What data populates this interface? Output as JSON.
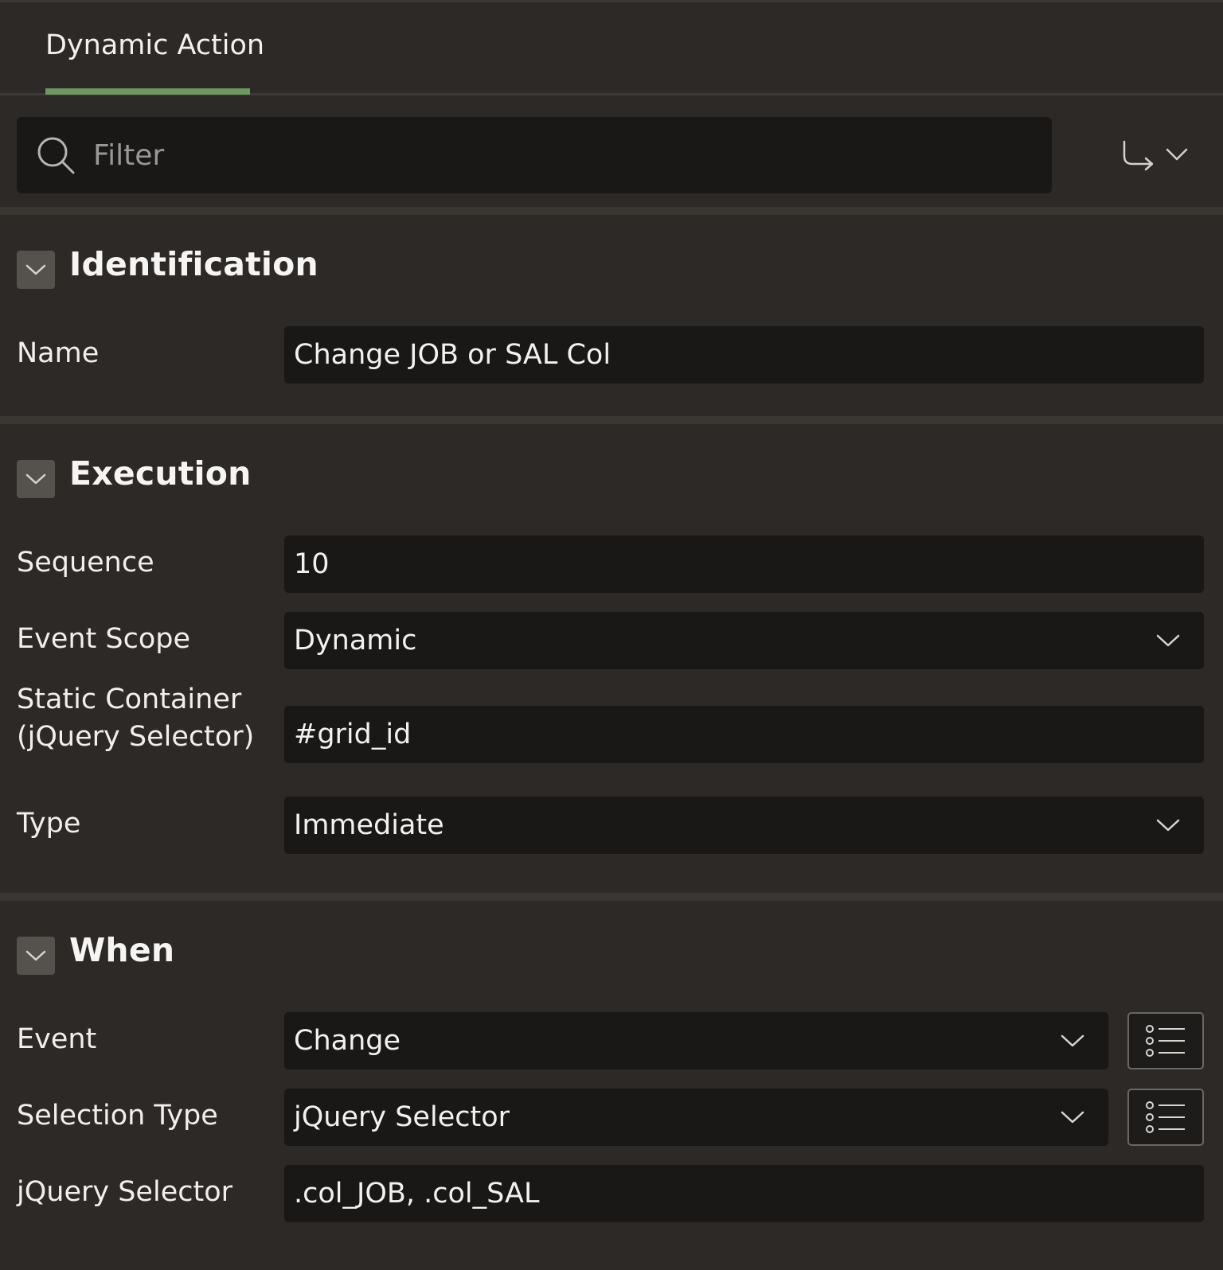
{
  "tabs": [
    {
      "label": "Dynamic Action"
    }
  ],
  "filter": {
    "placeholder": "Filter",
    "value": ""
  },
  "sections": {
    "identification": {
      "title": "Identification",
      "name_label": "Name",
      "name_value": "Change JOB or SAL Col"
    },
    "execution": {
      "title": "Execution",
      "sequence_label": "Sequence",
      "sequence_value": "10",
      "event_scope_label": "Event Scope",
      "event_scope_value": "Dynamic",
      "static_container_label_line1": "Static Container",
      "static_container_label_line2": "(jQuery Selector)",
      "static_container_value": "#grid_id",
      "type_label": "Type",
      "type_value": "Immediate"
    },
    "when": {
      "title": "When",
      "event_label": "Event",
      "event_value": "Change",
      "selection_type_label": "Selection Type",
      "selection_type_value": "jQuery Selector",
      "jquery_selector_label": "jQuery Selector",
      "jquery_selector_value": ".col_JOB, .col_SAL"
    }
  },
  "icons": {
    "search": "search-icon",
    "goto": "go-to-group-icon",
    "collapse": "chevron-down-icon",
    "select_arrow": "chevron-down-icon",
    "list": "list-icon"
  },
  "colors": {
    "background": "#2c2926",
    "field_background": "#191817",
    "tab_accent": "#6d9660",
    "section_divider": "#3a3733"
  }
}
